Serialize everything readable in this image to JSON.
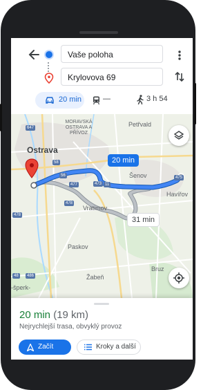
{
  "directions": {
    "from_value": "Vaše poloha",
    "to_value": "Krylovova 69"
  },
  "modes": {
    "car_time": "20 min",
    "transit_time": "—",
    "walk_time": "3 h 54"
  },
  "map": {
    "city_labels": {
      "ostrava": "Ostrava",
      "district": "MORAVSKÁ OSTRAVA A PŘÍVOZ",
      "petrvald": "Petřvald",
      "senov": "Šenov",
      "havirov": "Havířov",
      "vratimov": "Vratimov",
      "paskov": "Paskov",
      "zaben": "Žabeň",
      "bruz": "Bruz",
      "sperk": "-šperk-"
    },
    "route_callouts": {
      "selected": "20 min",
      "alternate": "31 min"
    },
    "road_shields": [
      "647",
      "58",
      "56",
      "477",
      "478",
      "473",
      "478",
      "11",
      "475",
      "486",
      "48"
    ]
  },
  "route_summary": {
    "time": "20 min",
    "distance": "(19 km)",
    "description": "Nejrychlejší trasa, obvyklý provoz",
    "start_label": "Začít",
    "steps_label": "Kroky a další"
  },
  "colors": {
    "accent": "#1a73e8",
    "eta_green": "#188038",
    "route_alt": "#9aa0a6",
    "destination_pin": "#ea4335"
  }
}
